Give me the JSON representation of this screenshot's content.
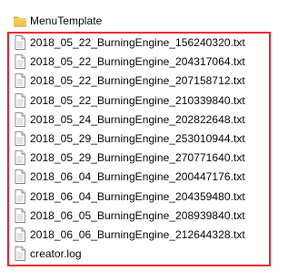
{
  "folder": {
    "name": "MenuTemplate",
    "icon": "folder-icon"
  },
  "files": [
    {
      "name": "2018_05_22_BurningEngine_156240320.txt",
      "icon": "text-file-icon"
    },
    {
      "name": "2018_05_22_BurningEngine_204317064.txt",
      "icon": "text-file-icon"
    },
    {
      "name": "2018_05_22_BurningEngine_207158712.txt",
      "icon": "text-file-icon"
    },
    {
      "name": "2018_05_22_BurningEngine_210339840.txt",
      "icon": "text-file-icon"
    },
    {
      "name": "2018_05_24_BurningEngine_202822648.txt",
      "icon": "text-file-icon"
    },
    {
      "name": "2018_05_29_BurningEngine_253010944.txt",
      "icon": "text-file-icon"
    },
    {
      "name": "2018_05_29_BurningEngine_270771640.txt",
      "icon": "text-file-icon"
    },
    {
      "name": "2018_06_04_BurningEngine_200447176.txt",
      "icon": "text-file-icon"
    },
    {
      "name": "2018_06_04_BurningEngine_204359480.txt",
      "icon": "text-file-icon"
    },
    {
      "name": "2018_06_05_BurningEngine_208939840.txt",
      "icon": "text-file-icon"
    },
    {
      "name": "2018_06_06_BurningEngine_212644328.txt",
      "icon": "text-file-icon"
    },
    {
      "name": "creator.log",
      "icon": "text-file-icon"
    }
  ],
  "colors": {
    "highlight": "#e8262c",
    "folder_body": "#f3c84c",
    "folder_tab": "#e0a92a"
  }
}
